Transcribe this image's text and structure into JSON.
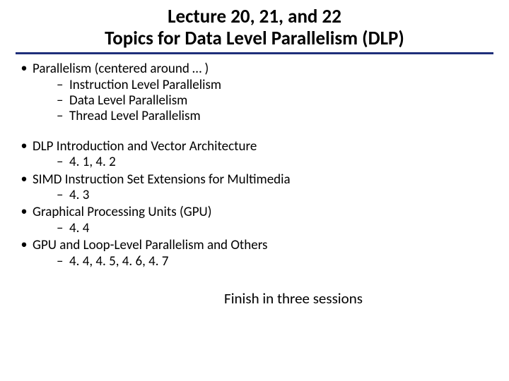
{
  "title_line1": "Lecture 20, 21, and 22",
  "title_line2": "Topics for Data Level Parallelism (DLP)",
  "items": [
    {
      "text": "Parallelism (centered around … )",
      "subs": [
        "Instruction Level Parallelism",
        "Data Level Parallelism",
        "Thread Level Parallelism"
      ],
      "gap_after": true
    },
    {
      "text": "DLP Introduction and Vector Architecture",
      "subs": [
        "4. 1, 4. 2"
      ],
      "gap_after": false
    },
    {
      "text": "SIMD Instruction Set Extensions for Multimedia",
      "subs": [
        "4. 3"
      ],
      "gap_after": false
    },
    {
      "text": "Graphical Processing Units (GPU)",
      "subs": [
        "4. 4"
      ],
      "gap_after": false
    },
    {
      "text": "GPU and Loop-Level Parallelism and Others",
      "subs": [
        "4. 4, 4. 5, 4. 6, 4. 7"
      ],
      "gap_after": false
    }
  ],
  "footer": "Finish in three sessions"
}
